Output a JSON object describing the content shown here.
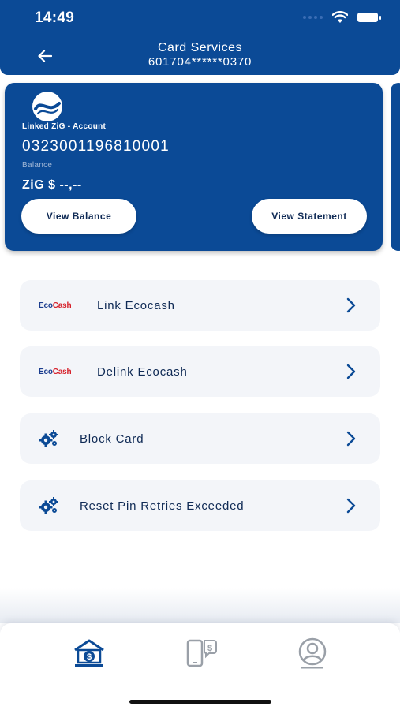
{
  "status_bar": {
    "time": "14:49"
  },
  "header": {
    "title": "Card Services",
    "card_number": "601704******0370"
  },
  "account_card": {
    "linked_label": "Linked ZiG - Account",
    "account_number": "0323001196810001",
    "balance_label": "Balance",
    "balance_value": "ZiG $ --,--",
    "view_balance_label": "View Balance",
    "view_statement_label": "View Statement"
  },
  "services": [
    {
      "label": "Link Ecocash",
      "icon": "ecocash-logo",
      "logo_eco": "Eco",
      "logo_cash": "Cash"
    },
    {
      "label": "Delink Ecocash",
      "icon": "ecocash-logo",
      "logo_eco": "Eco",
      "logo_cash": "Cash"
    },
    {
      "label": "Block Card",
      "icon": "gears-icon"
    },
    {
      "label": "Reset Pin Retries Exceeded",
      "icon": "gears-icon"
    }
  ],
  "tab_bar": {
    "items": [
      {
        "name": "bank-home-icon",
        "active": true
      },
      {
        "name": "mobile-payment-icon",
        "active": false
      },
      {
        "name": "profile-icon",
        "active": false
      }
    ]
  },
  "colors": {
    "primary": "#0b4a96",
    "row_bg": "#f3f5f9",
    "text_dark": "#0f2a55",
    "ecocash_red": "#d6202a",
    "inactive_icon": "#9aa0a8"
  }
}
